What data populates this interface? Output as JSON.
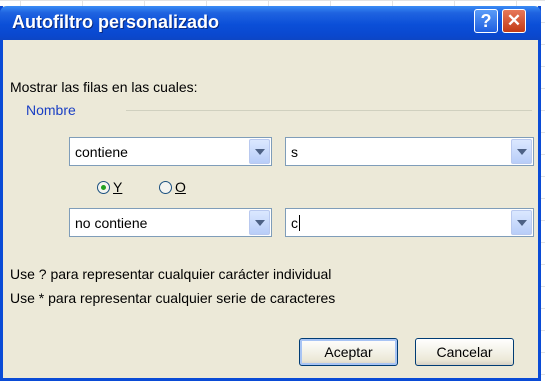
{
  "dialog": {
    "title": "Autofiltro personalizado",
    "help_glyph": "?",
    "close_glyph": "✕",
    "prompt": "Mostrar las filas en las cuales:",
    "group_label": "Nombre",
    "row1": {
      "operator": "contiene",
      "value": "s"
    },
    "logic": {
      "and_label": "Y",
      "or_label": "O",
      "selected": "Y"
    },
    "row2": {
      "operator": "no contiene",
      "value": "c"
    },
    "hint1": "Use ? para representar cualquier carácter individual",
    "hint2": "Use * para representar cualquier serie de caracteres",
    "ok_label": "Aceptar",
    "cancel_label": "Cancelar"
  },
  "colors": {
    "titlebar": "#0a4bd6",
    "dialog_bg": "#ece9d8",
    "group_label": "#1a3fc4"
  },
  "icons": [
    "help-icon",
    "close-icon",
    "dropdown-arrow-icon"
  ]
}
